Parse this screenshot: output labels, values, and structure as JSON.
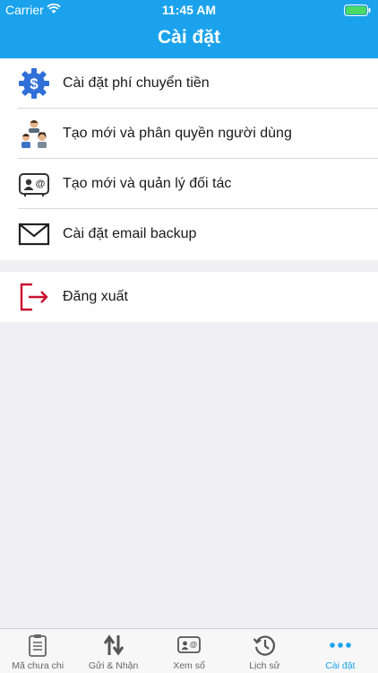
{
  "status_bar": {
    "carrier": "Carrier",
    "time": "11:45 AM"
  },
  "header": {
    "title": "Cài đặt"
  },
  "menu": {
    "items": [
      {
        "label": "Cài đặt phí chuyển tiền",
        "icon": "dollar-gear-icon"
      },
      {
        "label": "Tạo mới và phân quyền người dùng",
        "icon": "users-icon"
      },
      {
        "label": "Tạo mới và quản lý đối tác",
        "icon": "contact-card-icon"
      },
      {
        "label": "Cài đặt email backup",
        "icon": "email-icon"
      }
    ],
    "logout": {
      "label": "Đăng xuất",
      "icon": "logout-icon"
    }
  },
  "tabbar": {
    "tabs": [
      {
        "label": "Mã chưa chi",
        "icon": "clipboard-icon"
      },
      {
        "label": "Gửi & Nhận",
        "icon": "transfer-arrows-icon"
      },
      {
        "label": "Xem sổ",
        "icon": "contact-card-icon"
      },
      {
        "label": "Lịch sử",
        "icon": "history-icon"
      },
      {
        "label": "Cài đặt",
        "icon": "more-dots-icon",
        "active": true
      }
    ]
  },
  "colors": {
    "accent": "#1aa3ec",
    "logout": "#c8102e",
    "icon_blue": "#2f6fd8"
  }
}
